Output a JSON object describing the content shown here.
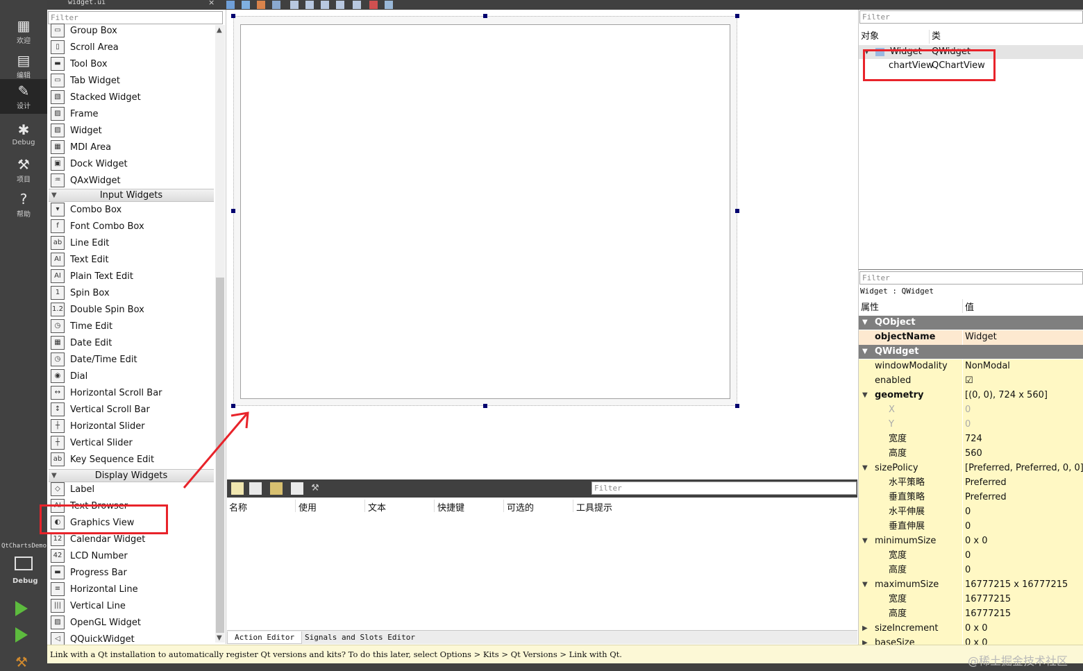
{
  "top_tab": {
    "file": "widget.ui",
    "close": "×"
  },
  "modes": [
    {
      "label": "欢迎",
      "icon": "grid-icon"
    },
    {
      "label": "编辑",
      "icon": "document-icon"
    },
    {
      "label": "设计",
      "icon": "pencil-icon"
    },
    {
      "label": "Debug",
      "icon": "bug-icon"
    },
    {
      "label": "项目",
      "icon": "wrench-icon"
    },
    {
      "label": "帮助",
      "icon": "help-icon"
    }
  ],
  "kit": {
    "project": "QtChartsDemo",
    "build": "Debug"
  },
  "widget_box": {
    "filter_placeholder": "Filter",
    "items_containers": [
      "Group Box",
      "Scroll Area",
      "Tool Box",
      "Tab Widget",
      "Stacked Widget",
      "Frame",
      "Widget",
      "MDI Area",
      "Dock Widget",
      "QAxWidget"
    ],
    "cat_input": "Input Widgets",
    "items_input": [
      "Combo Box",
      "Font Combo Box",
      "Line Edit",
      "Text Edit",
      "Plain Text Edit",
      "Spin Box",
      "Double Spin Box",
      "Time Edit",
      "Date Edit",
      "Date/Time Edit",
      "Dial",
      "Horizontal Scroll Bar",
      "Vertical Scroll Bar",
      "Horizontal Slider",
      "Vertical Slider",
      "Key Sequence Edit"
    ],
    "cat_display": "Display Widgets",
    "items_display": [
      "Label",
      "Text Browser",
      "Graphics View",
      "Calendar Widget",
      "LCD Number",
      "Progress Bar",
      "Horizontal Line",
      "Vertical Line",
      "OpenGL Widget",
      "QQuickWidget"
    ]
  },
  "action_editor": {
    "filter_placeholder": "Filter",
    "headers": [
      "名称",
      "使用",
      "文本",
      "快捷键",
      "可选的",
      "工具提示"
    ],
    "tabs": [
      "Action Editor",
      "Signals and Slots Editor"
    ]
  },
  "object_inspector": {
    "filter_placeholder": "Filter",
    "col_object": "对象",
    "col_class": "类",
    "rows": [
      {
        "object": "Widget",
        "class": "QWidget"
      },
      {
        "object": "chartView",
        "class": "QChartView"
      }
    ]
  },
  "property_editor": {
    "filter_placeholder": "Filter",
    "context": "Widget : QWidget",
    "col_property": "属性",
    "col_value": "值",
    "rows": [
      {
        "k": "QObject",
        "v": "",
        "t": "grp",
        "exp": "v"
      },
      {
        "k": "objectName",
        "v": "Widget",
        "t": "o",
        "bold": true
      },
      {
        "k": "QWidget",
        "v": "",
        "t": "grp",
        "exp": "v"
      },
      {
        "k": "windowModality",
        "v": "NonModal",
        "t": "y"
      },
      {
        "k": "enabled",
        "v": "☑",
        "t": "y"
      },
      {
        "k": "geometry",
        "v": "[(0, 0), 724 x 560]",
        "t": "y",
        "bold": true,
        "exp": "v"
      },
      {
        "k": "X",
        "v": "0",
        "t": "y",
        "sub": true,
        "dim": true
      },
      {
        "k": "Y",
        "v": "0",
        "t": "y",
        "sub": true,
        "dim": true
      },
      {
        "k": "宽度",
        "v": "724",
        "t": "y",
        "sub": true
      },
      {
        "k": "高度",
        "v": "560",
        "t": "y",
        "sub": true
      },
      {
        "k": "sizePolicy",
        "v": "[Preferred, Preferred, 0, 0]",
        "t": "y",
        "exp": "v"
      },
      {
        "k": "水平策略",
        "v": "Preferred",
        "t": "y",
        "sub": true
      },
      {
        "k": "垂直策略",
        "v": "Preferred",
        "t": "y",
        "sub": true
      },
      {
        "k": "水平伸展",
        "v": "0",
        "t": "y",
        "sub": true
      },
      {
        "k": "垂直伸展",
        "v": "0",
        "t": "y",
        "sub": true
      },
      {
        "k": "minimumSize",
        "v": "0 x 0",
        "t": "y",
        "exp": "v"
      },
      {
        "k": "宽度",
        "v": "0",
        "t": "y",
        "sub": true
      },
      {
        "k": "高度",
        "v": "0",
        "t": "y",
        "sub": true
      },
      {
        "k": "maximumSize",
        "v": "16777215 x 16777215",
        "t": "y",
        "exp": "v"
      },
      {
        "k": "宽度",
        "v": "16777215",
        "t": "y",
        "sub": true
      },
      {
        "k": "高度",
        "v": "16777215",
        "t": "y",
        "sub": true
      },
      {
        "k": "sizeIncrement",
        "v": "0 x 0",
        "t": "y",
        "exp": ">"
      },
      {
        "k": "baseSize",
        "v": "0 x 0",
        "t": "y",
        "exp": ">"
      }
    ]
  },
  "status_bar": {
    "message": "Link with a Qt installation to automatically register Qt versions and kits? To do this later, select Options > Kits > Qt Versions > Link with Qt."
  },
  "watermark": "@稀土掘金技术社区",
  "colors": {
    "annotation": "#e8232a",
    "selection_handle": "#00006f",
    "property_yellow": "#fff8c4",
    "property_group": "#7f7f7f"
  }
}
